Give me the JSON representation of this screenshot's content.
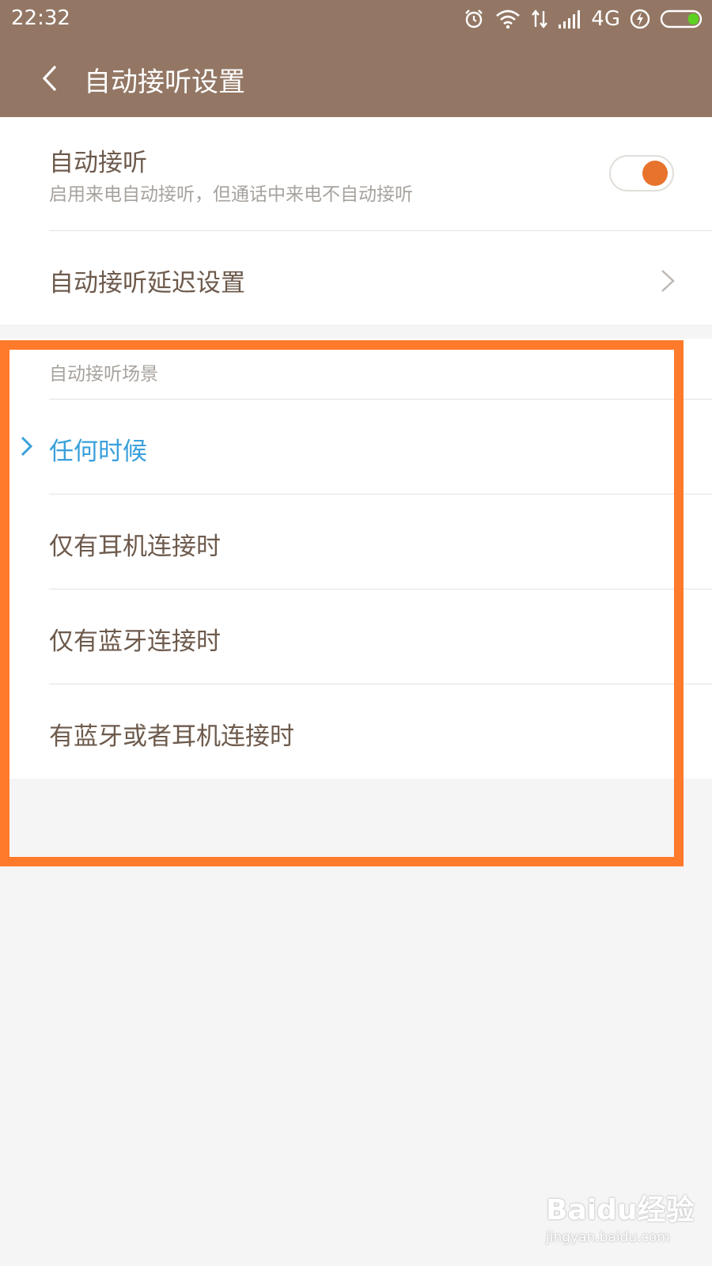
{
  "status_bar": {
    "time": "22:32",
    "network": "4G",
    "icons": [
      "alarm-icon",
      "wifi-icon",
      "data-transfer-icon",
      "signal-icon",
      "charging-icon",
      "battery-icon"
    ]
  },
  "header": {
    "title": "自动接听设置",
    "back_icon": "chevron-left-icon"
  },
  "settings": {
    "auto_answer": {
      "label": "自动接听",
      "description": "启用来电自动接听，但通话中来电不自动接听",
      "enabled": true
    },
    "delay": {
      "label": "自动接听延迟设置"
    }
  },
  "scenario": {
    "header": "自动接听场景",
    "options": [
      {
        "label": "任何时候",
        "selected": true
      },
      {
        "label": "仅有耳机连接时",
        "selected": false
      },
      {
        "label": "仅有蓝牙连接时",
        "selected": false
      },
      {
        "label": "有蓝牙或者耳机连接时",
        "selected": false
      }
    ]
  },
  "watermark": {
    "main": "Baidu经验",
    "sub": "jingyan.baidu.com"
  },
  "colors": {
    "header_bg": "#937764",
    "accent_orange": "#e8732c",
    "selected_blue": "#3aa0db",
    "highlight_frame": "#ff7a2b",
    "text_primary": "#6d5a4c",
    "text_secondary": "#a7a29d"
  }
}
